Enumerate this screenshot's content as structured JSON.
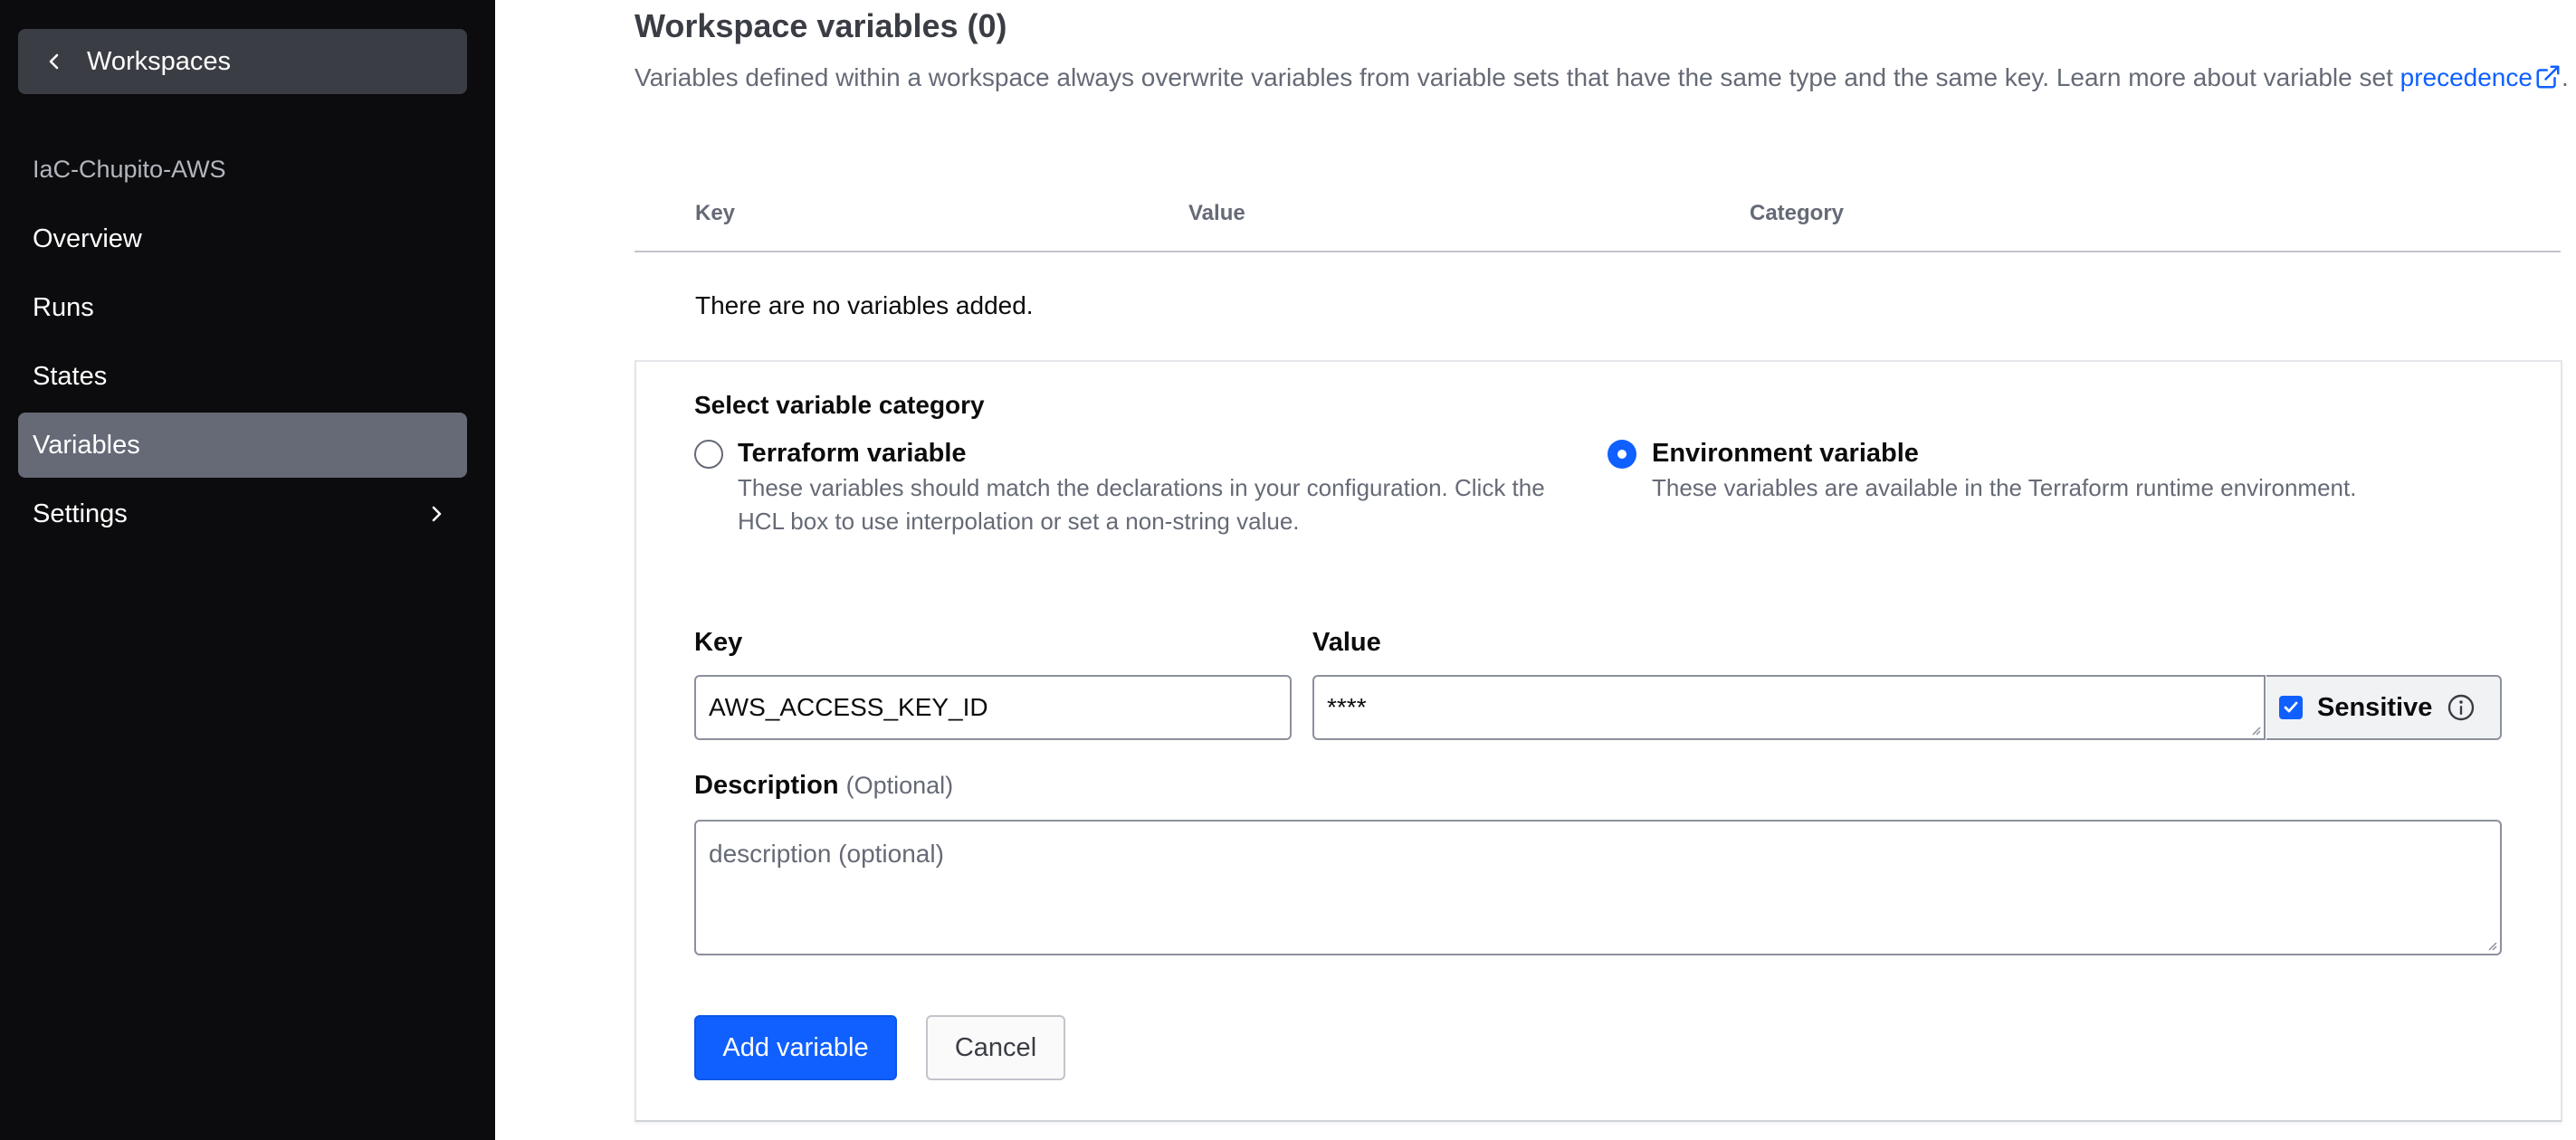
{
  "sidebar": {
    "back_label": "Workspaces",
    "workspace_name": "IaC-Chupito-AWS",
    "items": [
      {
        "label": "Overview"
      },
      {
        "label": "Runs"
      },
      {
        "label": "States"
      },
      {
        "label": "Variables",
        "active": true
      },
      {
        "label": "Settings"
      }
    ]
  },
  "main": {
    "title": "Workspace variables (0)",
    "description_text": "Variables defined within a workspace always overwrite variables from variable sets that have the same type and the same key. Learn more about variable set",
    "description_link": "precedence",
    "description_end": ".",
    "table": {
      "columns": [
        "Key",
        "Value",
        "Category"
      ],
      "empty_message": "There are no variables added."
    },
    "form": {
      "category_label": "Select variable category",
      "options": [
        {
          "title": "Terraform variable",
          "help": "These variables should match the declarations in your configuration. Click the HCL box to use interpolation or set a non-string value.",
          "selected": false
        },
        {
          "title": "Environment variable",
          "help": "These variables are available in the Terraform runtime environment.",
          "selected": true
        }
      ],
      "key_label": "Key",
      "key_value": "AWS_ACCESS_KEY_ID",
      "value_label": "Value",
      "value_value": "****",
      "sensitive_label": "Sensitive",
      "sensitive_checked": true,
      "description_label": "Description",
      "description_optional": "(Optional)",
      "description_placeholder": "description (optional)",
      "add_button": "Add variable",
      "cancel_button": "Cancel"
    }
  },
  "colors": {
    "sidebar_bg": "#0c0c0e",
    "active_item_bg": "#656a76",
    "accent": "#1060ff"
  }
}
